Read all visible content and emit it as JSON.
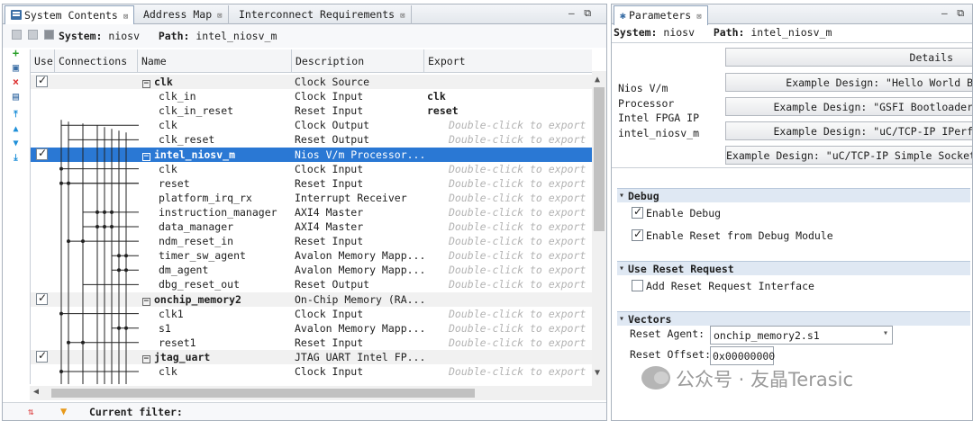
{
  "left": {
    "tabs": [
      {
        "label": "System Contents"
      },
      {
        "label": "Address Map"
      },
      {
        "label": "Interconnect Requirements"
      }
    ],
    "tab_close": "⊠",
    "window_controls": "– ⧉ ▭",
    "toolbar": {
      "system_label": "System:",
      "system_value": "niosv",
      "path_label": "Path:",
      "path_value": "intel_niosv_m"
    },
    "columns": {
      "use": "Use",
      "connections": "Connections",
      "name": "Name",
      "description": "Description",
      "export": "Export"
    },
    "rows": [
      {
        "name": "clk",
        "desc": "Clock Source",
        "export": "",
        "group": true,
        "checked": true
      },
      {
        "name": "clk_in",
        "desc": "Clock Input",
        "export": "clk",
        "bold_export": true
      },
      {
        "name": "clk_in_reset",
        "desc": "Reset Input",
        "export": "reset",
        "bold_export": true
      },
      {
        "name": "clk",
        "desc": "Clock Output",
        "export": "Double-click to export"
      },
      {
        "name": "clk_reset",
        "desc": "Reset Output",
        "export": "Double-click to export"
      },
      {
        "name": "intel_niosv_m",
        "desc": "Nios V/m Processor...",
        "export": "",
        "group": true,
        "checked": true,
        "selected": true
      },
      {
        "name": "clk",
        "desc": "Clock Input",
        "export": "Double-click to export"
      },
      {
        "name": "reset",
        "desc": "Reset Input",
        "export": "Double-click to export"
      },
      {
        "name": "platform_irq_rx",
        "desc": "Interrupt Receiver",
        "export": "Double-click to export"
      },
      {
        "name": "instruction_manager",
        "desc": "AXI4 Master",
        "export": "Double-click to export"
      },
      {
        "name": "data_manager",
        "desc": "AXI4 Master",
        "export": "Double-click to export"
      },
      {
        "name": "ndm_reset_in",
        "desc": "Reset Input",
        "export": "Double-click to export"
      },
      {
        "name": "timer_sw_agent",
        "desc": "Avalon Memory Mapp...",
        "export": "Double-click to export"
      },
      {
        "name": "dm_agent",
        "desc": "Avalon Memory Mapp...",
        "export": "Double-click to export"
      },
      {
        "name": "dbg_reset_out",
        "desc": "Reset Output",
        "export": "Double-click to export"
      },
      {
        "name": "onchip_memory2",
        "desc": "On-Chip Memory (RA...",
        "export": "",
        "group": true,
        "checked": true
      },
      {
        "name": "clk1",
        "desc": "Clock Input",
        "export": "Double-click to export"
      },
      {
        "name": "s1",
        "desc": "Avalon Memory Mapp...",
        "export": "Double-click to export"
      },
      {
        "name": "reset1",
        "desc": "Reset Input",
        "export": "Double-click to export"
      },
      {
        "name": "jtag_uart",
        "desc": "JTAG UART Intel FP...",
        "export": "",
        "group": true,
        "checked": true
      },
      {
        "name": "clk",
        "desc": "Clock Input",
        "export": "Double-click to export"
      }
    ],
    "status": {
      "filter_label": "Current filter:"
    }
  },
  "right": {
    "tab_label": "Parameters",
    "tab_close": "⊠",
    "window_controls": "– ⧉",
    "system_label": "System:",
    "system_value": "niosv",
    "path_label": "Path:",
    "path_value": "intel_niosv_m",
    "info_lines": [
      "Nios V/m",
      "Processor",
      "Intel FPGA IP",
      "intel_niosv_m"
    ],
    "buttons": [
      "Details",
      "Example Design: \"Hello World B",
      "Example Design: \"GSFI Bootloader",
      "Example Design: \"uC/TCP-IP IPerf",
      "Example Design: \"uC/TCP-IP Simple Socket"
    ],
    "sections": {
      "debug": "Debug",
      "reset_request": "Use Reset Request",
      "vectors": "Vectors"
    },
    "options": {
      "enable_debug": "Enable Debug",
      "enable_reset_debug": "Enable Reset from Debug Module",
      "add_reset_request": "Add Reset Request Interface"
    },
    "vectors": {
      "reset_agent_label": "Reset Agent:",
      "reset_agent_value": "onchip_memory2.s1",
      "reset_offset_label": "Reset Offset:",
      "reset_offset_value": "0x00000000"
    }
  },
  "watermark": "公众号 · 友晶Terasic",
  "colors": {
    "selection": "#2a78d4",
    "section_header": "#dfe8f3",
    "hint_text": "#b3b3b3"
  }
}
